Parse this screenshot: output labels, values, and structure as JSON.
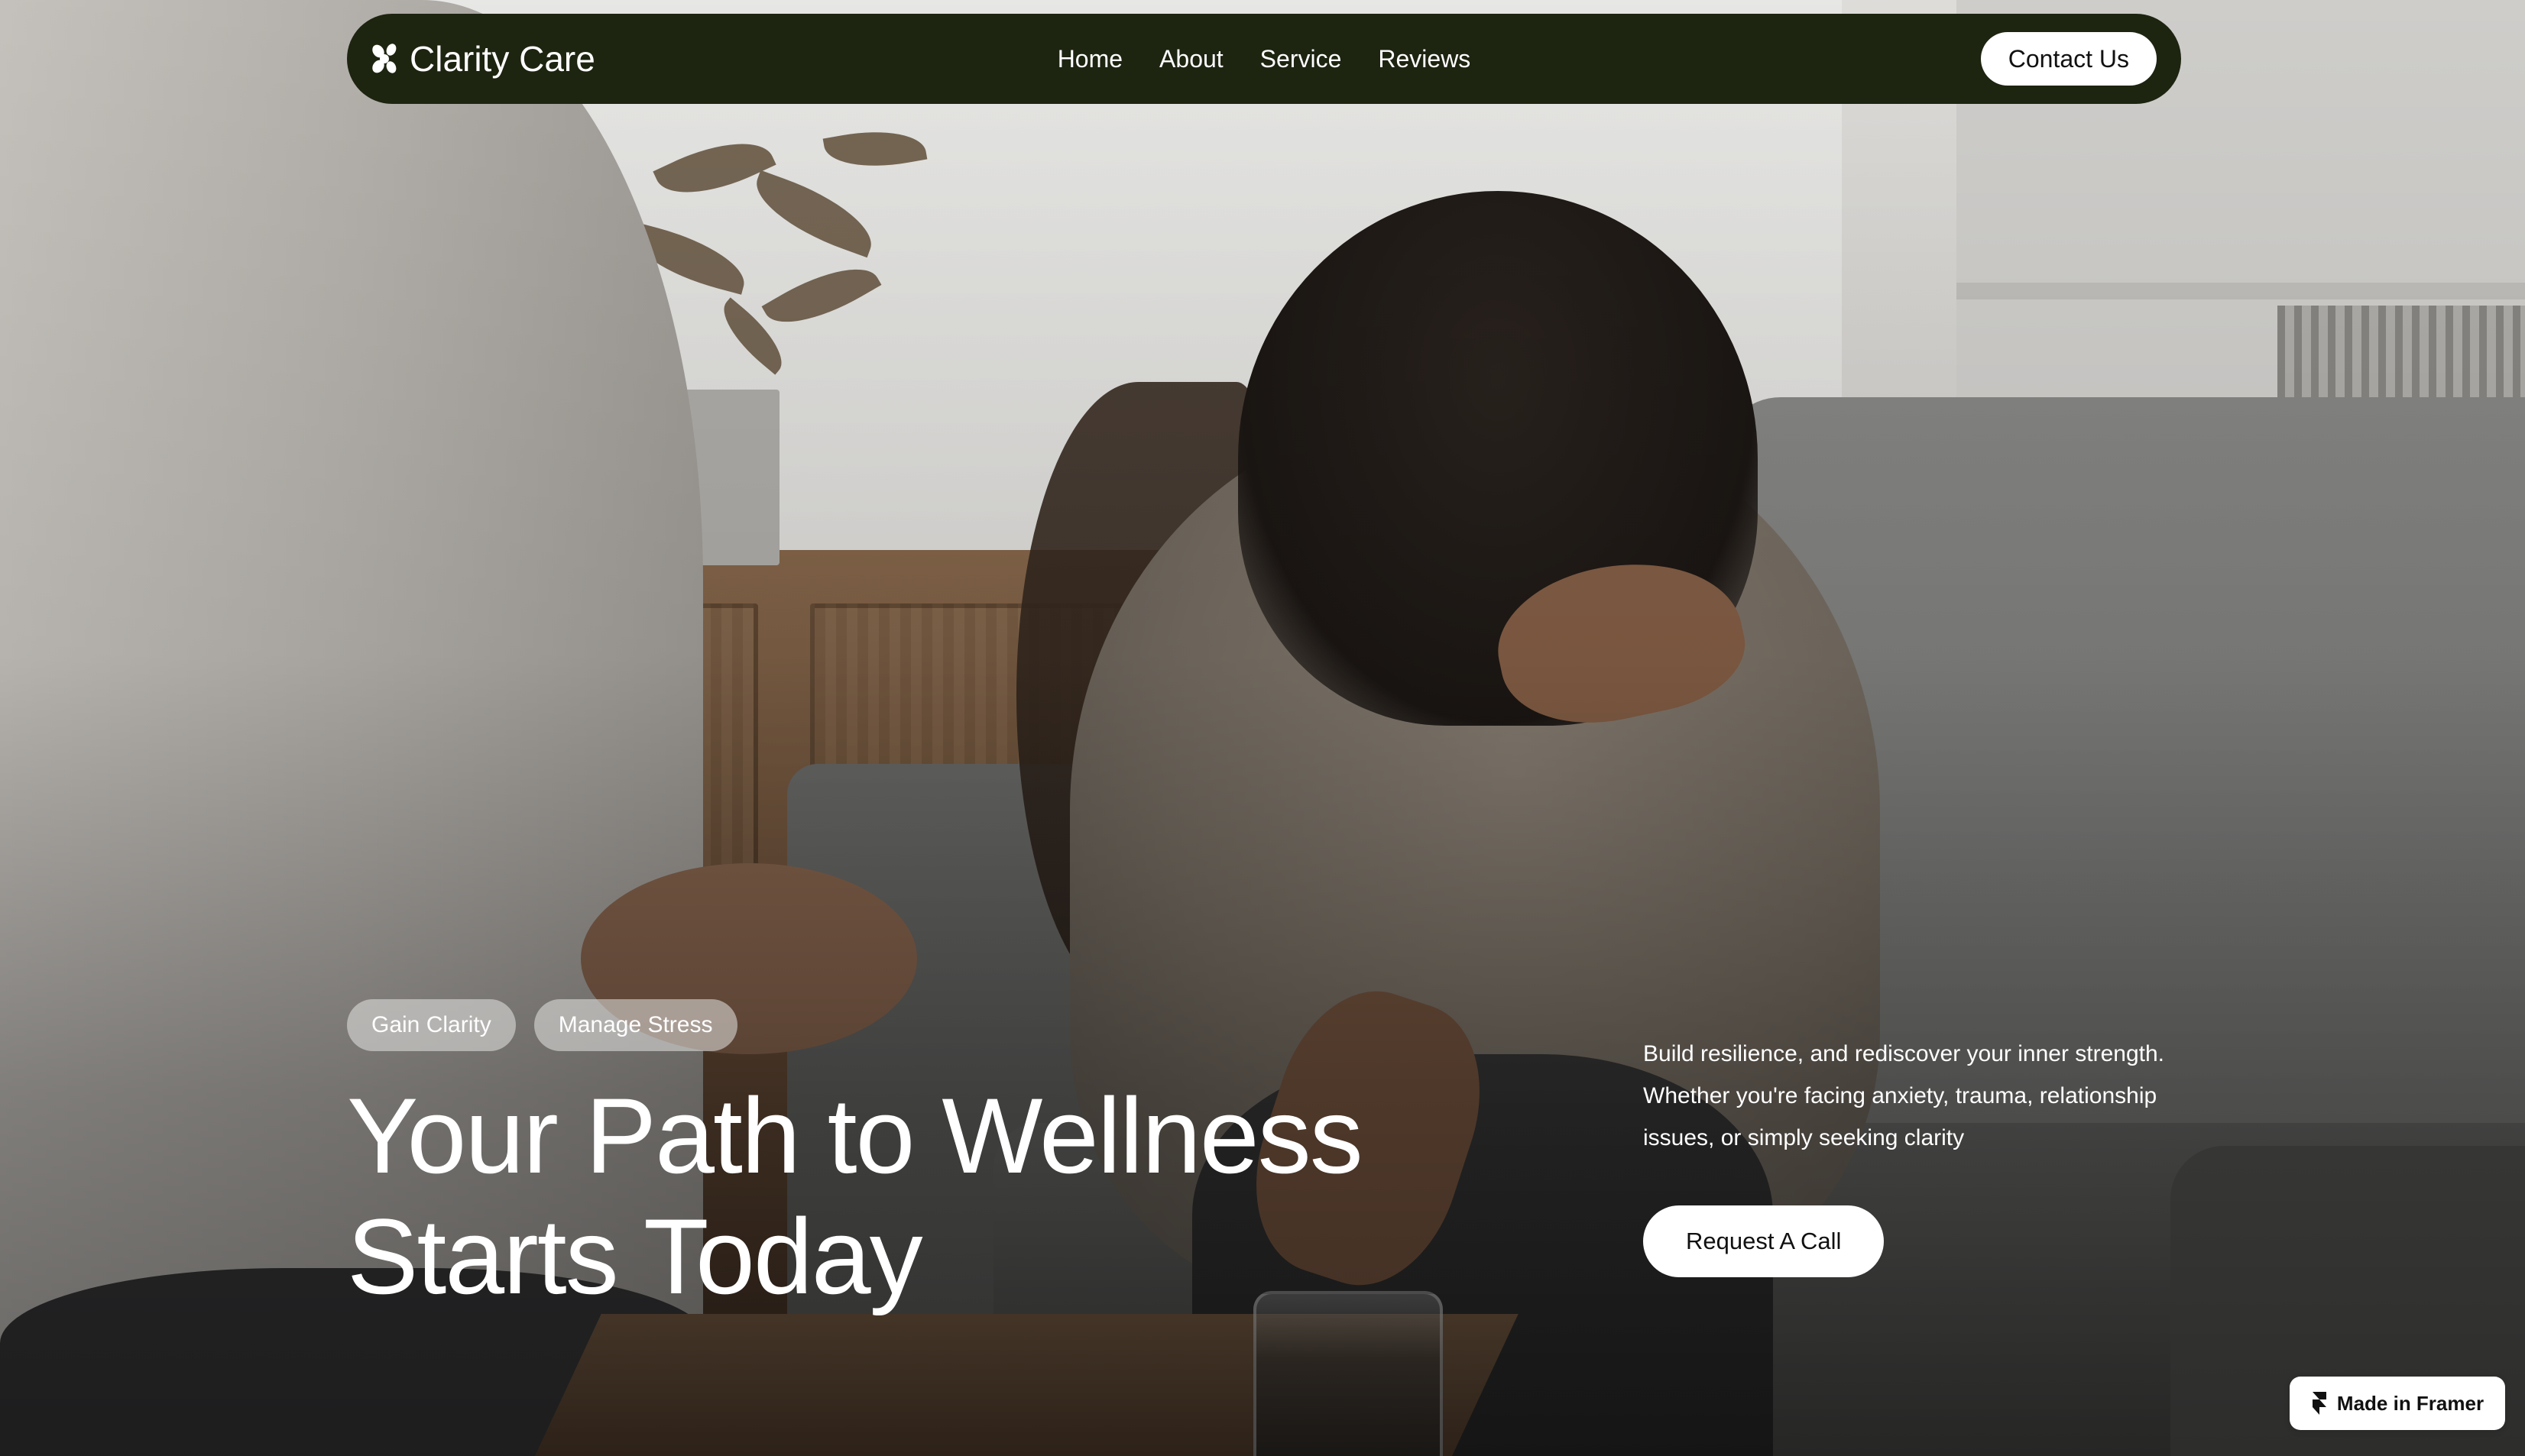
{
  "brand": {
    "name": "Clarity Care",
    "icon": "flower-logo-icon"
  },
  "nav": {
    "links": [
      "Home",
      "About",
      "Service",
      "Reviews"
    ],
    "contact_label": "Contact Us"
  },
  "hero": {
    "tags": [
      "Gain Clarity",
      "Manage Stress"
    ],
    "headline_line1": "Your Path to Wellness",
    "headline_line2": "Starts Today",
    "description": "Build resilience, and rediscover your inner strength. Whether you're facing anxiety, trauma, relationship issues, or simply seeking clarity",
    "cta_label": "Request A Call",
    "background_image": "therapy-session-photo"
  },
  "badge": {
    "label": "Made in Framer",
    "icon": "framer-icon"
  },
  "colors": {
    "nav_background": "#1d2410",
    "button_background": "#ffffff",
    "text_on_dark": "#ffffff"
  }
}
